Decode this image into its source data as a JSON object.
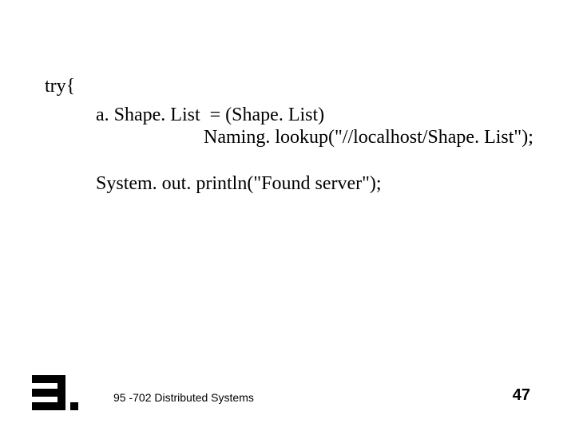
{
  "code": {
    "l1": "try{",
    "l2": "a. Shape. List  = (Shape. List)",
    "l3": "Naming. lookup(\"//localhost/Shape. List\");",
    "l4": "System. out. println(\"Found server\");"
  },
  "footer": {
    "course": "95 -702 Distributed Systems",
    "page": "47"
  }
}
